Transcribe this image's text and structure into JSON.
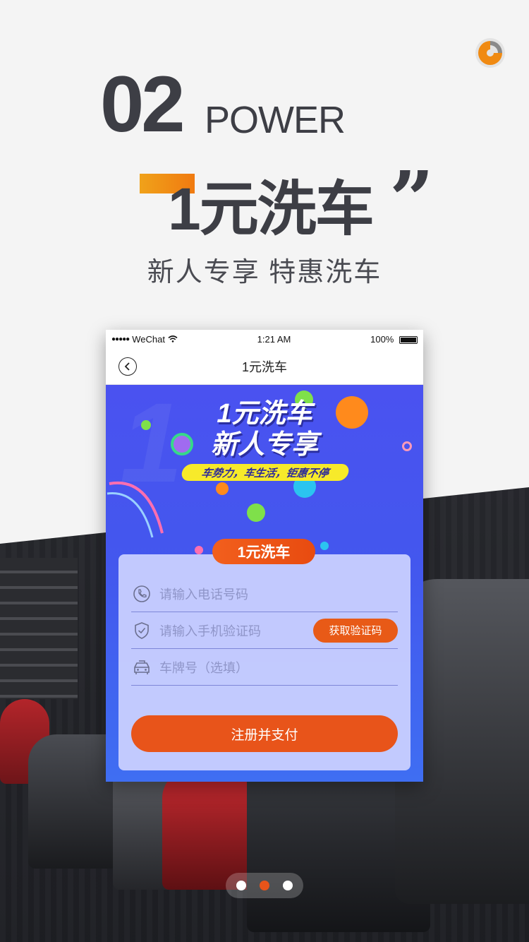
{
  "hero": {
    "number": "02",
    "power": "POWER",
    "title": "1元洗车",
    "quote": "”",
    "subtitle": "新人专享 特惠洗车"
  },
  "phone": {
    "status": {
      "carrier": "WeChat",
      "time": "1:21 AM",
      "battery": "100%"
    },
    "nav": {
      "title": "1元洗车",
      "back_icon": "chevron-left-icon"
    },
    "banner": {
      "headline_1": "1元洗车",
      "headline_2": "新人专享",
      "tagline": "车势力，车生活，钜惠不停",
      "pill": "1元洗车"
    },
    "form": {
      "phone_placeholder": "请输入电话号码",
      "code_placeholder": "请输入手机验证码",
      "get_code_label": "获取验证码",
      "plate_placeholder": "车牌号（选填）",
      "submit_label": "注册并支付"
    }
  },
  "pager": {
    "count": 3,
    "active_index": 1
  },
  "colors": {
    "accent": "#e8541a",
    "banner_blue": "#4a52f0",
    "text_dark": "#3d3e45"
  }
}
